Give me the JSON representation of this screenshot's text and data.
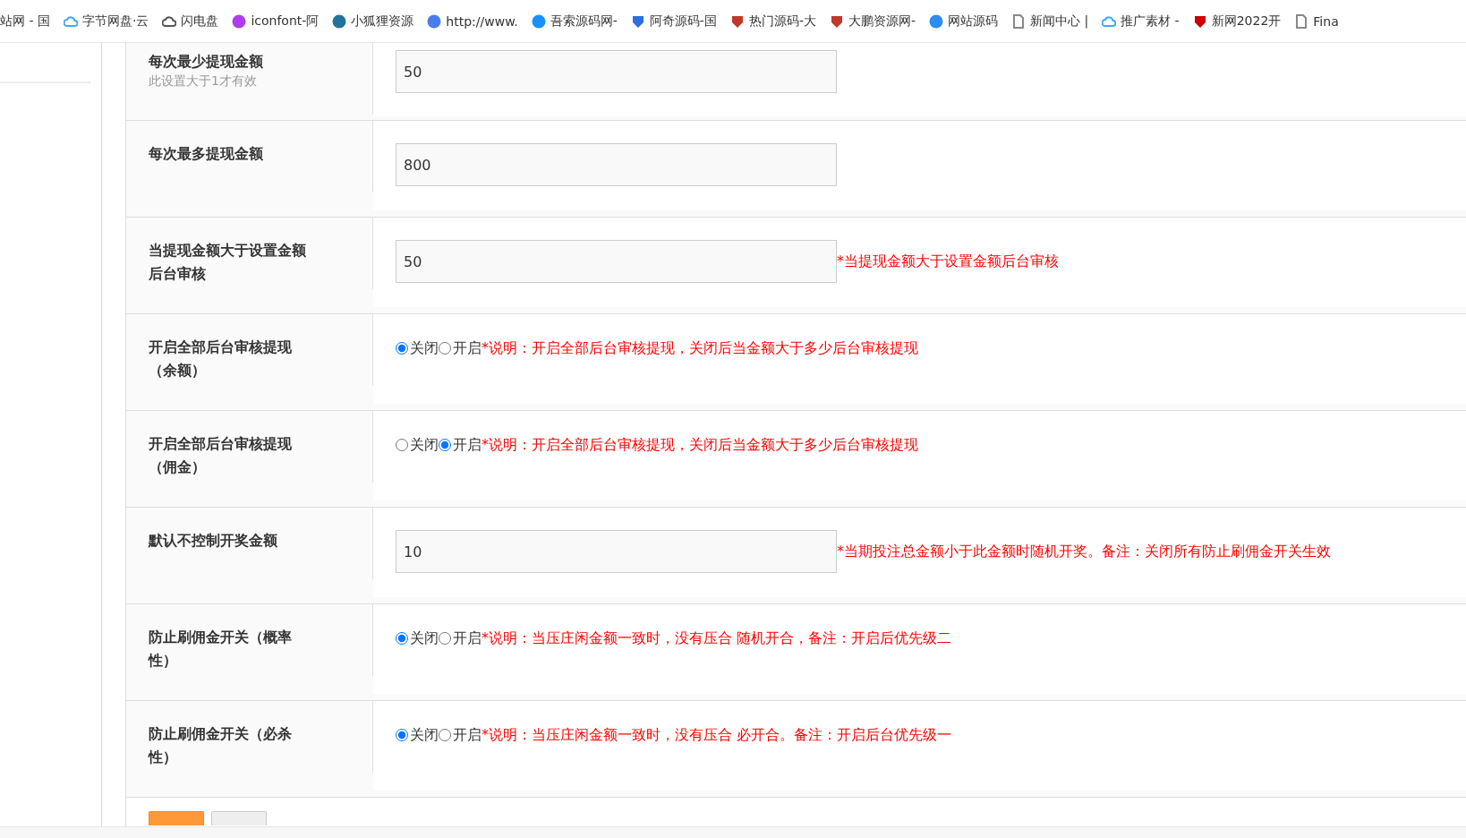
{
  "bookmarks": [
    {
      "label": "站网 - 国",
      "kind": "none"
    },
    {
      "label": "字节网盘·云",
      "kind": "cloud",
      "color": "#3fa9f5"
    },
    {
      "label": "闪电盘",
      "kind": "cloud",
      "color": "#555555"
    },
    {
      "label": "iconfont-阿",
      "kind": "round",
      "color": "#b03cf0"
    },
    {
      "label": "小狐狸资源",
      "kind": "round",
      "color": "#21759b"
    },
    {
      "label": "http://www.",
      "kind": "round",
      "color": "#4a7cf0"
    },
    {
      "label": "吾索源码网-",
      "kind": "round",
      "color": "#1890ff"
    },
    {
      "label": "阿奇源码-国",
      "kind": "shield",
      "color": "#2b6fe0"
    },
    {
      "label": "热门源码-大",
      "kind": "shield",
      "color": "#c0392b"
    },
    {
      "label": "大鹏资源网-",
      "kind": "shield",
      "color": "#c0392b"
    },
    {
      "label": "网站源码",
      "kind": "round",
      "color": "#2d8cf0"
    },
    {
      "label": "新闻中心 |",
      "kind": "page",
      "color": "#888888"
    },
    {
      "label": "推广素材 -",
      "kind": "cloud",
      "color": "#3fa9f5"
    },
    {
      "label": "新网2022开",
      "kind": "shield",
      "color": "#cc0000"
    },
    {
      "label": "Fina",
      "kind": "page",
      "color": "#888888"
    }
  ],
  "rows": [
    {
      "kind": "input",
      "label": "每次最少提现金额",
      "hint": "此设置大于1才有效",
      "value": "50"
    },
    {
      "kind": "input",
      "label": "每次最多提现金额",
      "value": "800"
    },
    {
      "kind": "input",
      "label": "当提现金额大于设置金额后台审核",
      "value": "50",
      "note": "*当提现金额大于设置金额后台审核"
    },
    {
      "kind": "radio",
      "label": "开启全部后台审核提现（余额）",
      "options": [
        {
          "label": "关闭",
          "selected": true
        },
        {
          "label": "开启",
          "selected": false
        }
      ],
      "note": "*说明：开启全部后台审核提现，关闭后当金额大于多少后台审核提现"
    },
    {
      "kind": "radio",
      "label": "开启全部后台审核提现（佣金）",
      "options": [
        {
          "label": "关闭",
          "selected": false
        },
        {
          "label": "开启",
          "selected": true
        }
      ],
      "note": "*说明：开启全部后台审核提现，关闭后当金额大于多少后台审核提现"
    },
    {
      "kind": "input",
      "label": "默认不控制开奖金额",
      "value": "10",
      "note": "*当期投注总金额小于此金额时随机开奖。备注：关闭所有防止刷佣金开关生效"
    },
    {
      "kind": "radio",
      "label": "防止刷佣金开关（概率性）",
      "options": [
        {
          "label": "关闭",
          "selected": true
        },
        {
          "label": "开启",
          "selected": false
        }
      ],
      "note": "*说明：当压庄闲金额一致时，没有压合 随机开合，备注：开启后优先级二"
    },
    {
      "kind": "radio",
      "label": "防止刷佣金开关（必杀性）",
      "options": [
        {
          "label": "关闭",
          "selected": true
        },
        {
          "label": "开启",
          "selected": false
        }
      ],
      "note": "*说明：当压庄闲金额一致时，没有压合 必开合。备注：开启后台优先级一"
    }
  ]
}
